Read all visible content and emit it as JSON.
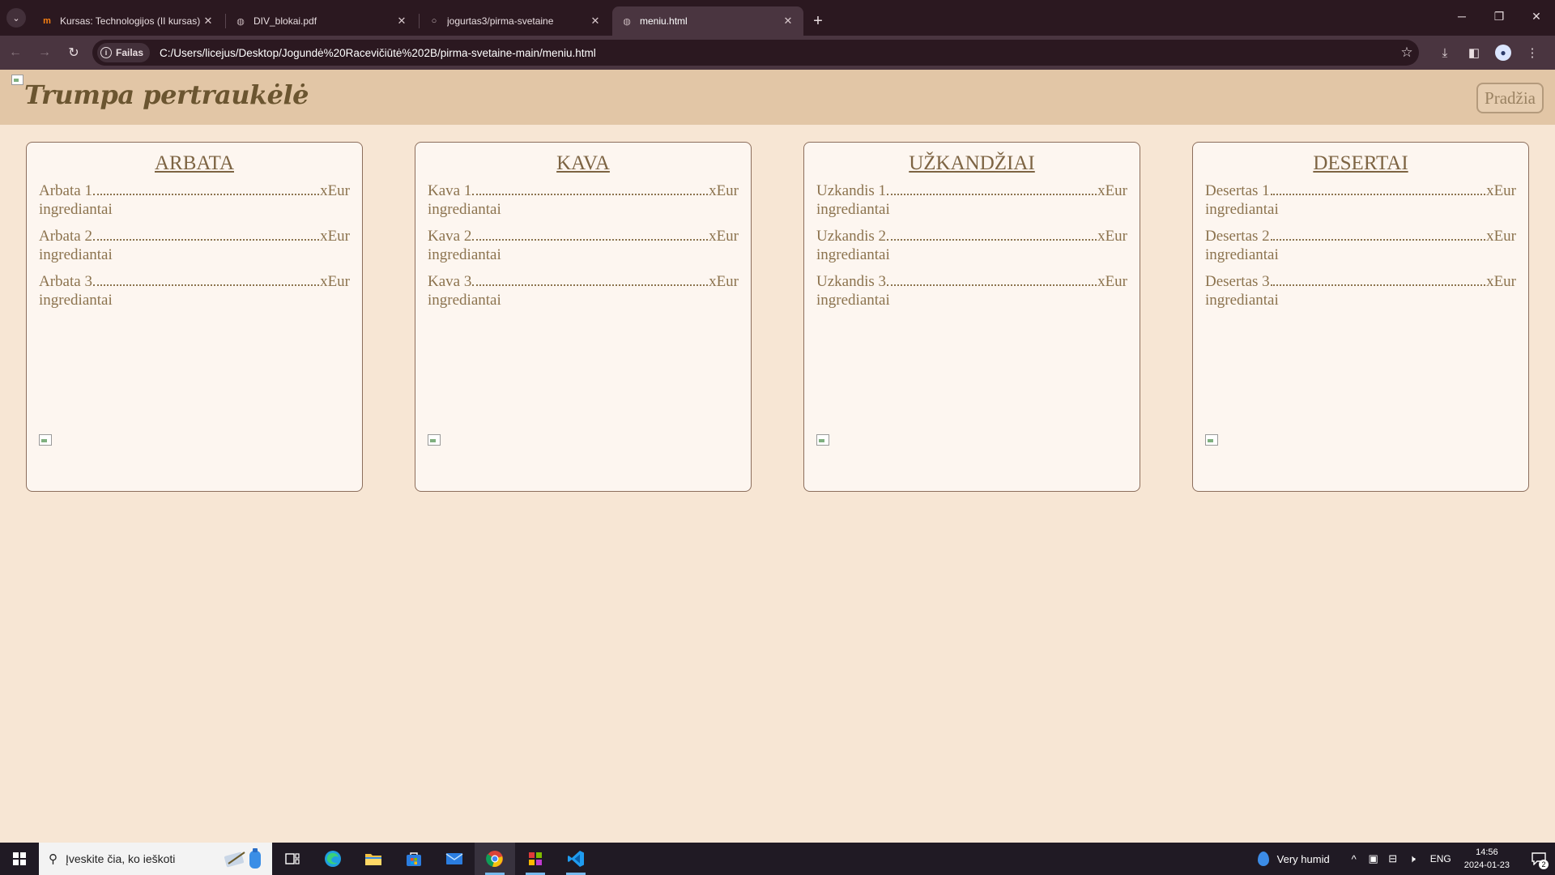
{
  "browser": {
    "tabs": [
      {
        "title": "Kursas: Technologijos (II kursas)",
        "icon": "moodle-icon",
        "active": false
      },
      {
        "title": "DIV_blokai.pdf",
        "icon": "globe-icon",
        "active": false
      },
      {
        "title": "jogurtas3/pirma-svetaine",
        "icon": "github-icon",
        "active": false
      },
      {
        "title": "meniu.html",
        "icon": "globe-icon",
        "active": true
      }
    ],
    "address_chip": "Failas",
    "url": "C:/Users/licejus/Desktop/Jogundė%20Racevičiūtė%202B/pirma-svetaine-main/meniu.html"
  },
  "page": {
    "title": "Trumpa pertraukėlė",
    "home_button": "Pradžia",
    "cards": [
      {
        "title": "ARBATA",
        "items": [
          {
            "name": "Arbata 1",
            "price": "xEur",
            "desc": "ingrediantai"
          },
          {
            "name": "Arbata 2",
            "price": "xEur",
            "desc": "ingrediantai"
          },
          {
            "name": "Arbata 3",
            "price": "xEur",
            "desc": "ingrediantai"
          }
        ]
      },
      {
        "title": "KAVA",
        "items": [
          {
            "name": "Kava 1",
            "price": "xEur",
            "desc": "ingrediantai"
          },
          {
            "name": "Kava 2",
            "price": "xEur",
            "desc": "ingrediantai"
          },
          {
            "name": "Kava 3",
            "price": "xEur",
            "desc": "ingrediantai"
          }
        ]
      },
      {
        "title": "UŽKANDŽIAI",
        "items": [
          {
            "name": "Uzkandis 1",
            "price": "xEur",
            "desc": "ingrediantai"
          },
          {
            "name": "Uzkandis 2",
            "price": "xEur",
            "desc": "ingrediantai"
          },
          {
            "name": "Uzkandis 3",
            "price": "xEur",
            "desc": "ingrediantai"
          }
        ]
      },
      {
        "title": "DESERTAI",
        "items": [
          {
            "name": "Desertas 1",
            "price": "xEur",
            "desc": "ingrediantai"
          },
          {
            "name": "Desertas 2",
            "price": "xEur",
            "desc": "ingrediantai"
          },
          {
            "name": "Desertas 3",
            "price": "xEur",
            "desc": "ingrediantai"
          }
        ]
      }
    ]
  },
  "taskbar": {
    "search_placeholder": "Įveskite čia, ko ieškoti",
    "weather": "Very humid",
    "language": "ENG",
    "time": "14:56",
    "date": "2024-01-23",
    "notification_count": "2"
  },
  "colors": {
    "page_bg": "#f7e6d4",
    "header_bg": "#e2c6a6",
    "card_bg": "#fdf6f0",
    "text": "#8c734e"
  }
}
